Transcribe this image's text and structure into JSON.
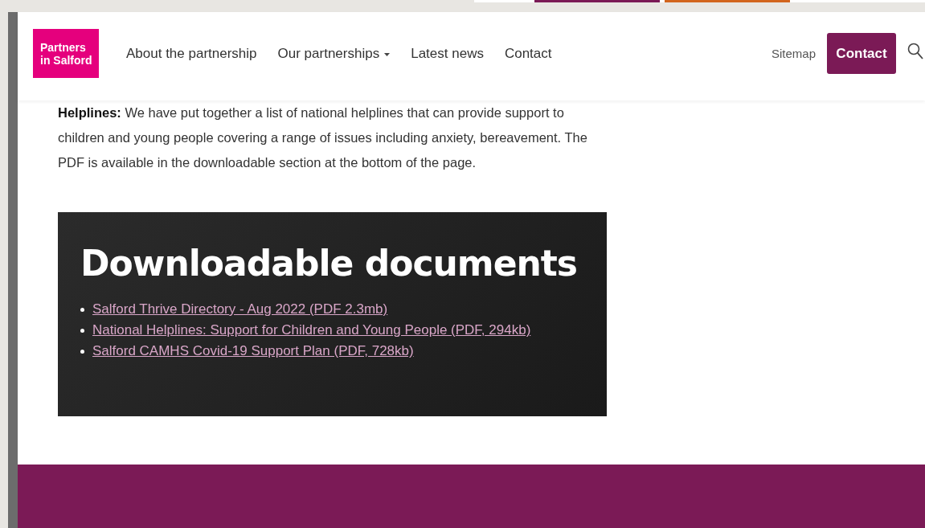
{
  "header": {
    "logo": [
      "Partners",
      "in Salford"
    ],
    "nav": [
      {
        "label": "About the partnership",
        "kind": "link"
      },
      {
        "label": "Our partnerships",
        "kind": "dropdown"
      },
      {
        "label": "Latest news",
        "kind": "link"
      },
      {
        "label": "Contact",
        "kind": "link"
      }
    ],
    "sitemap": "Sitemap",
    "contact_button": "Contact"
  },
  "intro": "**Helplines:** We have put together a list of national helplines that can provide support to children and young people covering a range of issues including anxiety, bereavement. The PDF is available in the downloadable section at the bottom of the page.",
  "downloads": {
    "title": "Downloadable documents",
    "links": [
      "Salford Thrive Directory - Aug 2022 (PDF 2.3mb)",
      "National Helplines: Support for Children and Young People (PDF, 294kb)",
      "Salford CAMHS Covid-19 Support Plan (PDF, 728kb)"
    ]
  }
}
